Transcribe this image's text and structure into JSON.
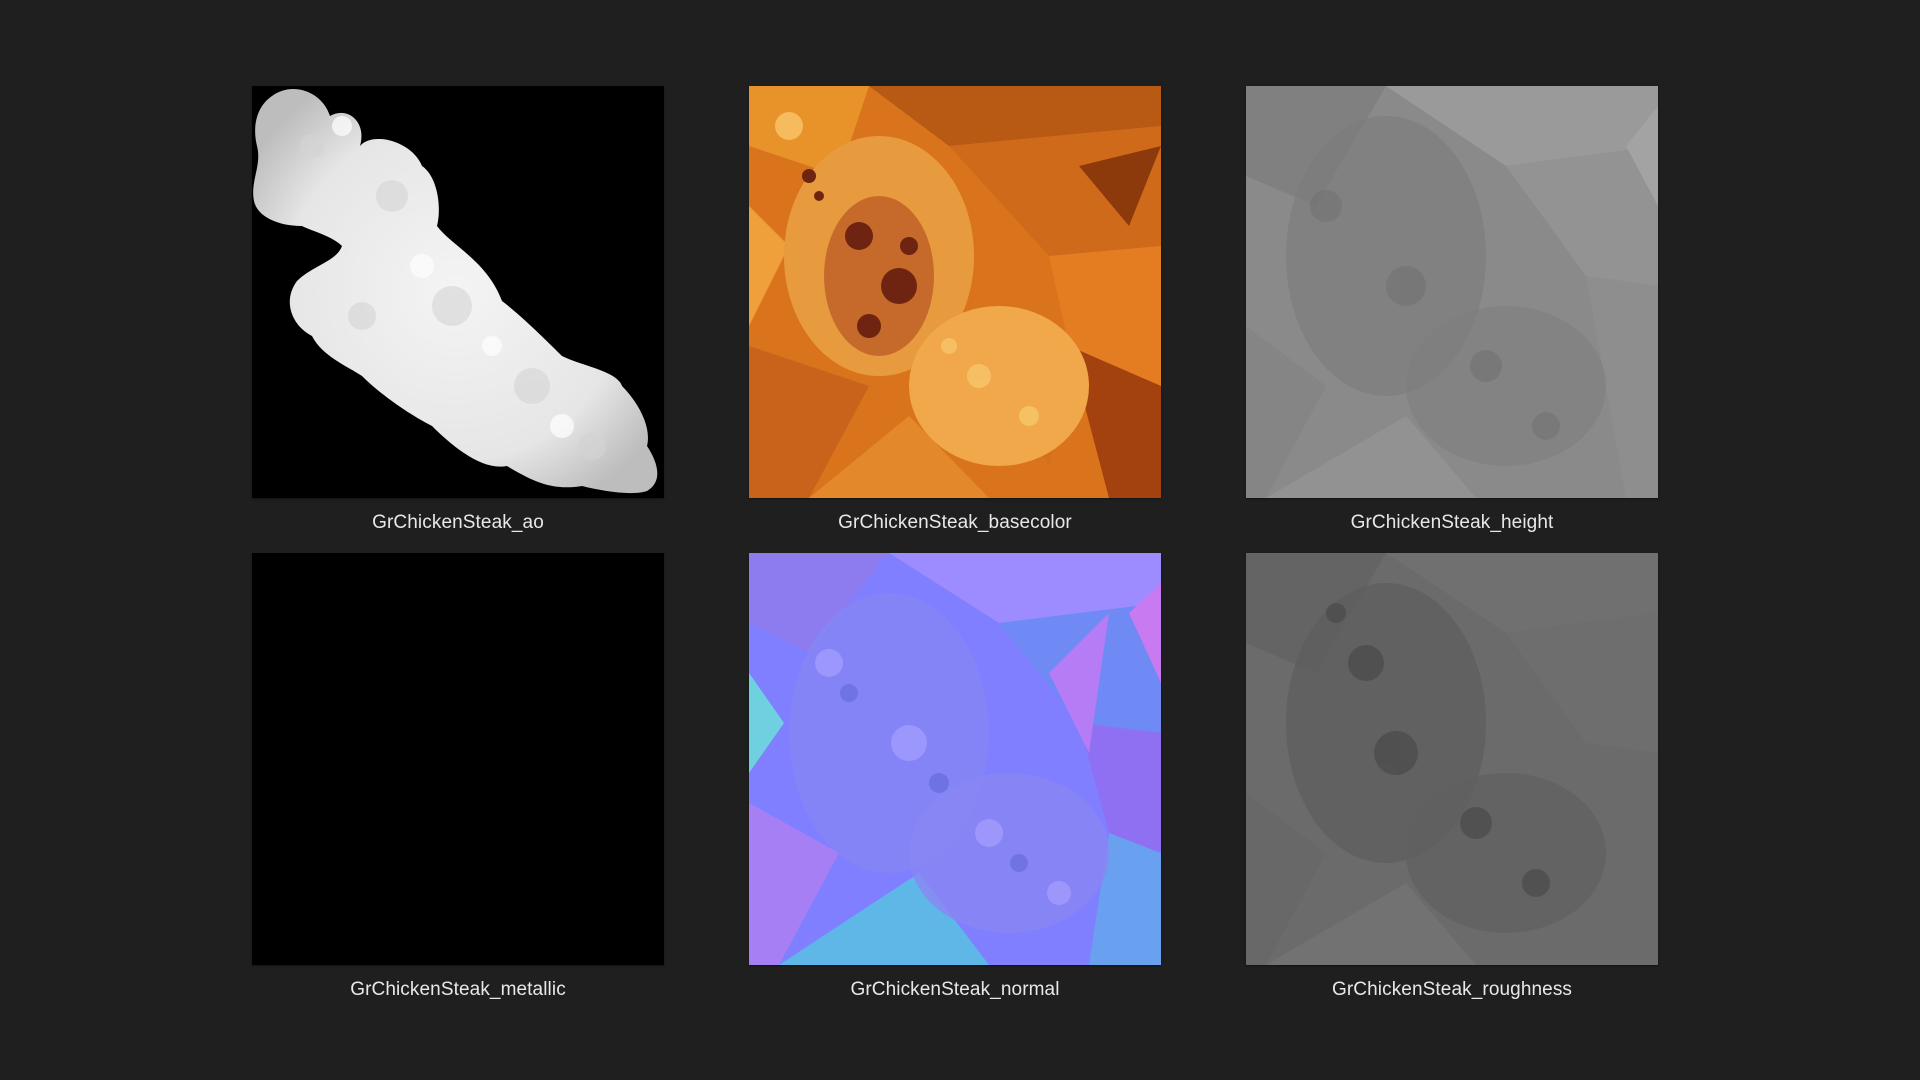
{
  "files": [
    {
      "id": "ao",
      "name": "GrChickenSteak_ao"
    },
    {
      "id": "basecolor",
      "name": "GrChickenSteak_basecolor"
    },
    {
      "id": "height",
      "name": "GrChickenSteak_height"
    },
    {
      "id": "metallic",
      "name": "GrChickenSteak_metallic"
    },
    {
      "id": "normal",
      "name": "GrChickenSteak_normal"
    },
    {
      "id": "roughness",
      "name": "GrChickenSteak_roughness"
    }
  ],
  "colors": {
    "background": "#1f1f1f",
    "caption": "#e8e8e8",
    "metallic_fill": "#000000",
    "height_base": "#8a8a8a",
    "roughness_base": "#6b6b6b"
  }
}
